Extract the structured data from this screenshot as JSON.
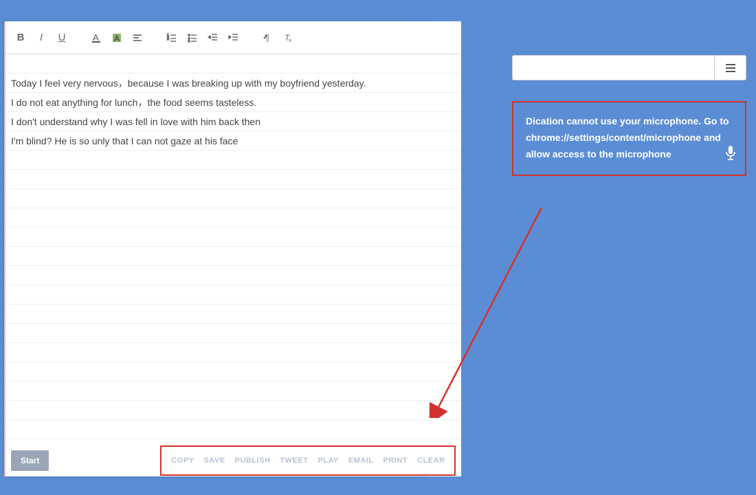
{
  "toolbar": {
    "icons": [
      "bold",
      "italic",
      "underline",
      "font-color",
      "highlight",
      "align",
      "ordered-list",
      "unordered-list",
      "outdent",
      "indent",
      "rtl",
      "clear-format"
    ]
  },
  "editor": {
    "lines": [
      "Today I feel very nervous，because I was breaking up with my boyfriend yesterday.",
      "I do not eat anything for lunch，the food seems tasteless.",
      "I don't understand why I was fell in love with him back then",
      "I'm blind? He is so unly that I can not gaze at his face"
    ]
  },
  "start_label": "Start",
  "actions": {
    "copy": "COPY",
    "save": "SAVE",
    "publish": "PUBLISH",
    "tweet": "TWEET",
    "play": "PLAY",
    "email": "EMAIL",
    "print": "PRINT",
    "clear": "CLEAR"
  },
  "search": {
    "placeholder": ""
  },
  "error": {
    "message": "Dication cannot use your microphone. Go to chrome://settings/content/microphone and allow access to the microphone"
  }
}
